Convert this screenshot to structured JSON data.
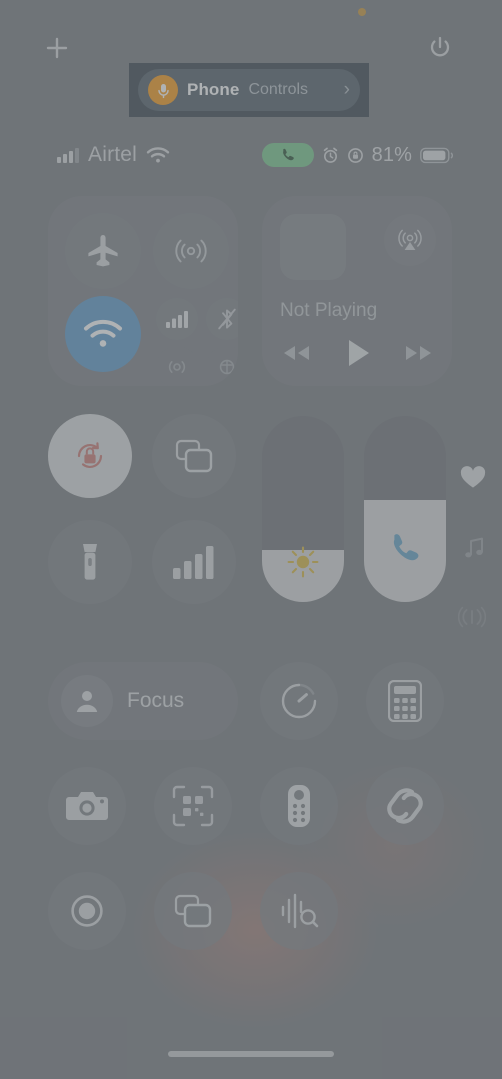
{
  "device": {
    "platform": "iOS",
    "screen": "Control Center",
    "privacy_indicator": "microphone-active-orange-dot",
    "home_indicator": true
  },
  "colors": {
    "background": "#71757a",
    "panel": "rgba(124,128,133,0.62)",
    "wifi_active": "#5494c8",
    "mic_orange": "#f5940f",
    "call_green": "#72c588",
    "slider_fill": "#d4d6d7",
    "brightness_sun": "#d8b435",
    "call_volume_blue": "#5b9ec4",
    "rotation_lock_red": "#c9746e",
    "banner_bg": "#2f3b45",
    "banner_pill": "#495762"
  },
  "top_bar": {
    "add_label": "+",
    "add_name": "add-control-button",
    "power_name": "power-button"
  },
  "dynamic_island": {
    "app_name": "Phone",
    "subtitle": "Controls",
    "chevron": "›",
    "mic_icon": "microphone-icon"
  },
  "status_bar": {
    "carrier": "Airtel",
    "signal_bars": 4,
    "wifi": true,
    "call_active": true,
    "alarm_set": true,
    "rotation_locked": true,
    "battery_percent": "81%",
    "battery_level": 0.81
  },
  "connectivity": {
    "title": "Connectivity",
    "controls": [
      {
        "name": "airplane-mode-button",
        "label": "Airplane Mode",
        "state": "off"
      },
      {
        "name": "airdrop-button",
        "label": "AirDrop",
        "state": "off"
      },
      {
        "name": "wifi-button",
        "label": "Wi-Fi",
        "state": "on"
      },
      {
        "name": "cellular-data-button",
        "label": "Cellular Data",
        "state": "on"
      },
      {
        "name": "bluetooth-button",
        "label": "Bluetooth",
        "state": "off"
      },
      {
        "name": "personal-hotspot-button",
        "label": "Personal Hotspot",
        "state": "off"
      },
      {
        "name": "satellite-button",
        "label": "Satellite",
        "state": "off"
      }
    ]
  },
  "media": {
    "status_text": "Not Playing",
    "artwork": "album-art-placeholder",
    "airplay": "airplay-audio-icon",
    "transport": [
      {
        "name": "rewind-button",
        "icon": "rewind-icon"
      },
      {
        "name": "play-button",
        "icon": "play-icon"
      },
      {
        "name": "fast-forward-button",
        "icon": "fast-forward-icon"
      }
    ]
  },
  "toggles": [
    {
      "name": "rotation-lock-button",
      "label": "Portrait Orientation Lock",
      "state": "on"
    },
    {
      "name": "screen-mirroring-button",
      "label": "Screen Mirroring",
      "state": "off"
    },
    {
      "name": "flashlight-button",
      "label": "Flashlight",
      "state": "off"
    },
    {
      "name": "cellular-signal-button",
      "label": "Cellular",
      "state": "off"
    }
  ],
  "sliders": [
    {
      "name": "brightness-slider",
      "label": "Brightness",
      "value_percent": 28,
      "glyph": "sun-icon"
    },
    {
      "name": "volume-slider",
      "label": "Call Volume",
      "value_percent": 55,
      "glyph": "phone-handset-icon"
    }
  ],
  "side_rail": [
    {
      "name": "hearing-button",
      "icon": "heart-icon"
    },
    {
      "name": "music-haptics-button",
      "icon": "music-note-icon"
    },
    {
      "name": "sound-output-button",
      "icon": "haptics-icon"
    }
  ],
  "focus": {
    "name": "focus-button",
    "label": "Focus",
    "icon": "person-icon"
  },
  "quick_controls": [
    {
      "name": "timer-button",
      "label": "Timer",
      "icon": "timer-icon"
    },
    {
      "name": "calculator-button",
      "label": "Calculator",
      "icon": "calculator-icon"
    }
  ],
  "app_shortcuts": [
    {
      "name": "camera-button",
      "label": "Camera",
      "icon": "camera-icon"
    },
    {
      "name": "code-scanner-button",
      "label": "Code Scanner",
      "icon": "qr-code-icon"
    },
    {
      "name": "apple-tv-remote-button",
      "label": "Apple TV Remote",
      "icon": "remote-icon"
    },
    {
      "name": "shazam-button",
      "label": "Music Recognition",
      "icon": "shazam-icon"
    }
  ],
  "bottom_controls": [
    {
      "name": "screen-record-button",
      "label": "Screen Recording",
      "icon": "record-icon"
    },
    {
      "name": "screen-mirroring-button-2",
      "label": "Screen Mirroring",
      "icon": "mirroring-icon"
    },
    {
      "name": "sound-recognition-button",
      "label": "Sound Recognition",
      "icon": "sound-recognition-icon"
    }
  ]
}
